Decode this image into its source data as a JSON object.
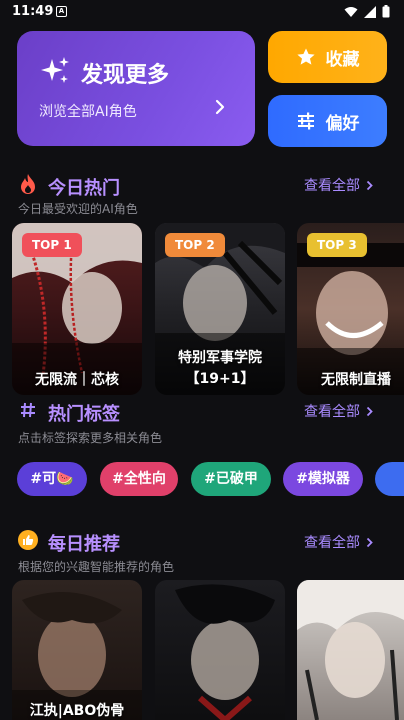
{
  "status": {
    "time": "11:49",
    "notif": "A"
  },
  "hero": {
    "discover_title": "发现更多",
    "discover_sub": "浏览全部AI角色",
    "fav_label": "收藏",
    "pref_label": "偏好"
  },
  "hot": {
    "title": "今日热门",
    "subtitle": "今日最受欢迎的AI角色",
    "see_all": "查看全部",
    "cards": [
      {
        "rank": "TOP 1",
        "name": "无限流｜芯核",
        "rank_color": "#f0505a"
      },
      {
        "rank": "TOP 2",
        "name_line1": "特别军事学院",
        "name_line2": "【19+1】",
        "rank_color": "#f08a3a"
      },
      {
        "rank": "TOP 3",
        "name": "无限制直播",
        "rank_color": "#e8c030"
      }
    ]
  },
  "tags": {
    "title": "热门标签",
    "subtitle": "点击标签探索更多相关角色",
    "see_all": "查看全部",
    "items": [
      {
        "label": "#可🍉",
        "color": "#5b3fd8"
      },
      {
        "label": "#全性向",
        "color": "#e0406a"
      },
      {
        "label": "#已破甲",
        "color": "#1fa67a"
      },
      {
        "label": "#模拟器",
        "color": "#7b48e0"
      }
    ]
  },
  "recommend": {
    "title": "每日推荐",
    "subtitle": "根据您的兴趣智能推荐的角色",
    "see_all": "查看全部",
    "cards": [
      {
        "name": "江执|ABO伪骨"
      },
      {
        "name": ""
      },
      {
        "name": ""
      }
    ]
  }
}
